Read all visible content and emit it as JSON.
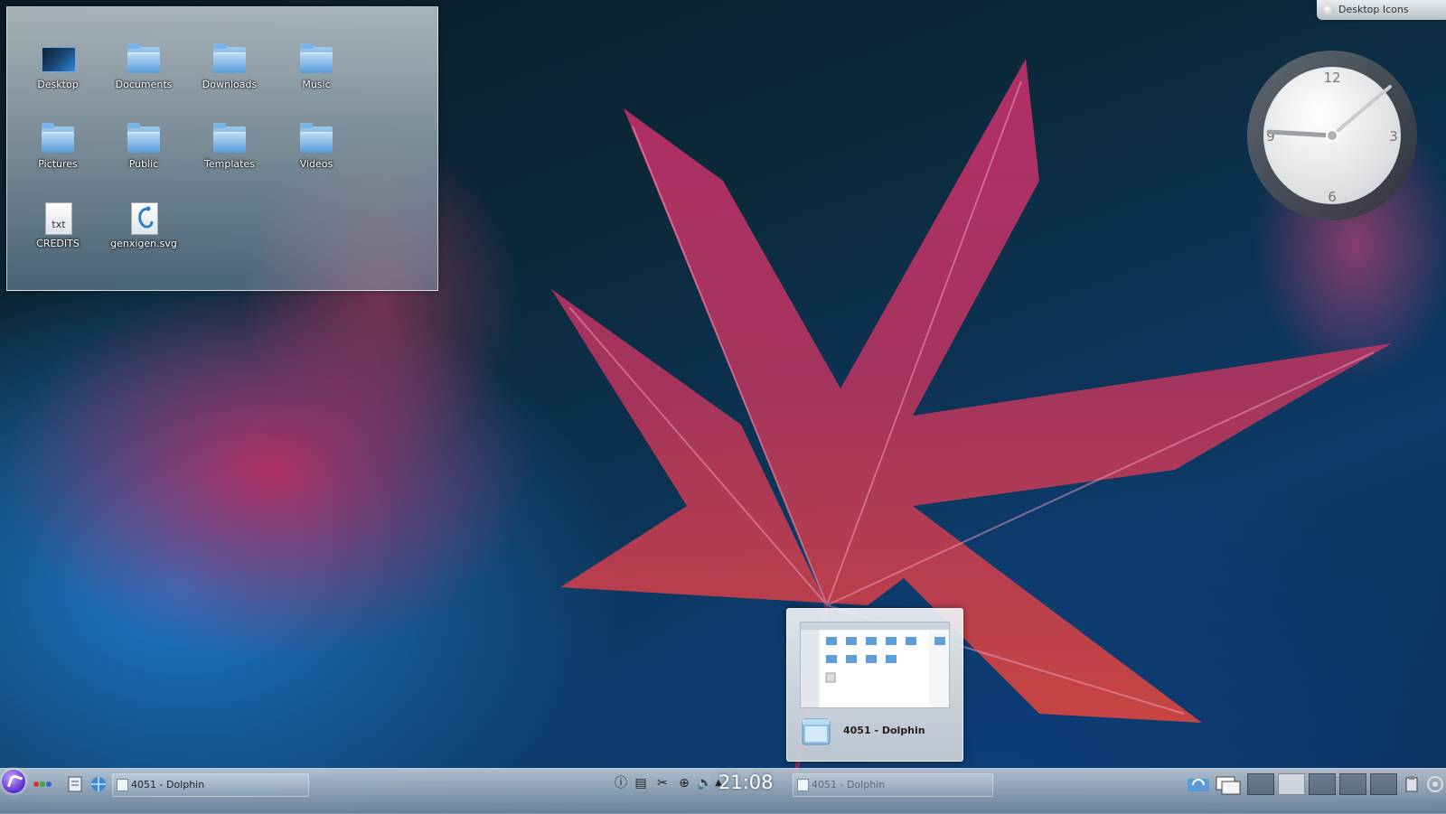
{
  "desktop_button": {
    "label": "Desktop Icons"
  },
  "folder_view": {
    "items": [
      {
        "label": "Desktop",
        "icon": "desktop-folder-icon"
      },
      {
        "label": "Documents",
        "icon": "folder-icon"
      },
      {
        "label": "Downloads",
        "icon": "folder-icon"
      },
      {
        "label": "Music",
        "icon": "folder-icon"
      },
      {
        "label": "Pictures",
        "icon": "folder-icon"
      },
      {
        "label": "Public",
        "icon": "folder-icon"
      },
      {
        "label": "Templates",
        "icon": "folder-icon"
      },
      {
        "label": "Videos",
        "icon": "folder-icon"
      },
      {
        "label": "CREDITS",
        "icon": "text-file-icon",
        "badge": "txt"
      },
      {
        "label": "genxigen.svg",
        "icon": "svg-file-icon"
      }
    ]
  },
  "analog_clock": {
    "numerals": [
      "12",
      "3",
      "6",
      "9"
    ]
  },
  "preview": {
    "title": "4051 - Dolphin"
  },
  "panel": {
    "task_left": "4051 - Dolphin",
    "task_right": "4051 - Dolphin",
    "time": "21:08"
  },
  "colors": {
    "panel": "#aab8c6",
    "kicker": "#6a35d8",
    "leaf": "#c8305a"
  }
}
